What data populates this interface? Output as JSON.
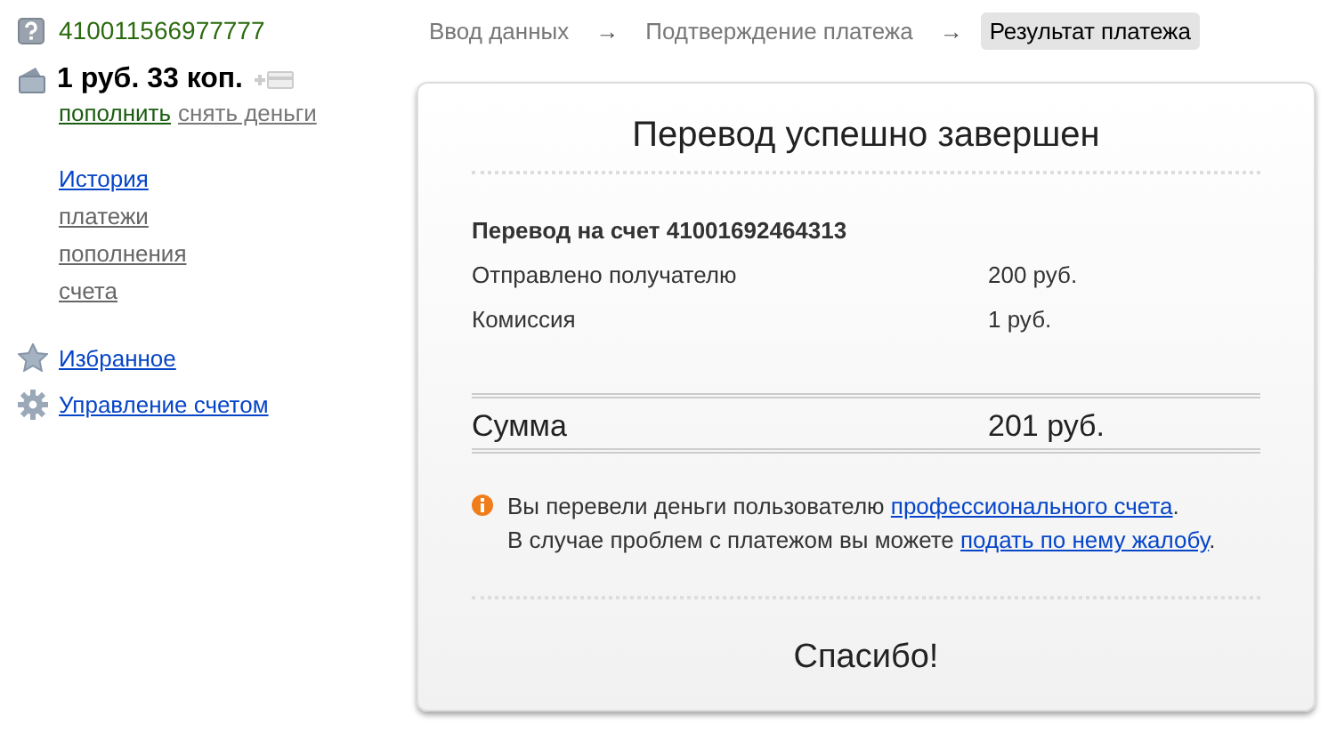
{
  "account": {
    "number": "410011566977777",
    "balance": "1 руб. 33 коп.",
    "actions": [
      {
        "label": "пополнить",
        "kind": "primary"
      },
      {
        "label": "снять деньги",
        "kind": "secondary"
      }
    ]
  },
  "nav": [
    {
      "label": "История",
      "kind": "main"
    },
    {
      "label": "платежи",
      "kind": "sub"
    },
    {
      "label": "пополнения",
      "kind": "sub"
    },
    {
      "label": "счета",
      "kind": "sub"
    }
  ],
  "extra_links": [
    {
      "label": "Избранное",
      "kind": "star"
    },
    {
      "label": "Управление счетом",
      "kind": "gear"
    }
  ],
  "steps": [
    {
      "label": "Ввод данных",
      "selected": false
    },
    {
      "label": "Подтверждение платежа",
      "selected": false
    },
    {
      "label": "Результат платежа",
      "selected": true
    }
  ],
  "step_arrow": "→",
  "result": {
    "title": "Перевод успешно завершен",
    "subtitle": "Перевод на счет 41001692464313",
    "rows": [
      {
        "label": "Отправлено получателю",
        "value": "200 руб."
      },
      {
        "label": "Комиссия",
        "value": "1 руб."
      }
    ],
    "total": {
      "label": "Сумма",
      "value": "201 руб."
    },
    "notice": [
      {
        "before": "Вы перевели деньги пользователю ",
        "link": "профессионального счета",
        "after": "."
      },
      {
        "before": "В случае проблем с платежом вы можете ",
        "link": "подать по нему жалобу",
        "after": "."
      }
    ],
    "thanks": "Спасибо!"
  }
}
